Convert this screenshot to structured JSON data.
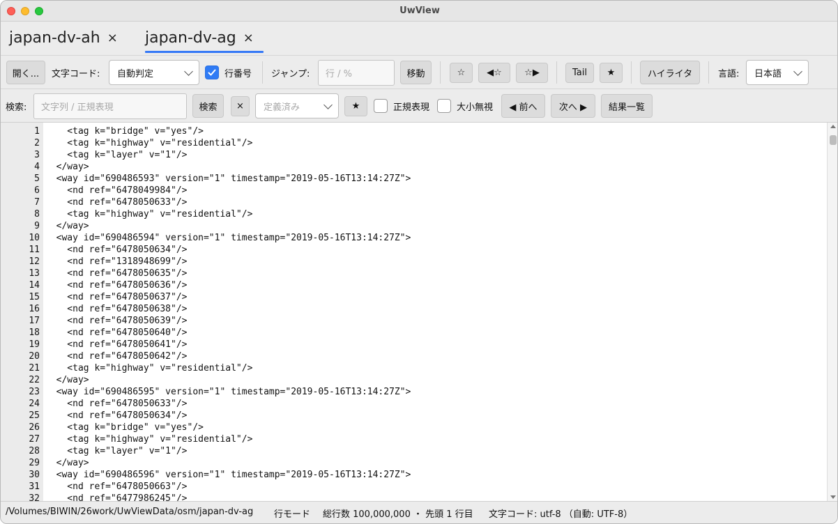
{
  "window": {
    "title": "UwView"
  },
  "tabs": [
    {
      "label": "japan-dv-ah",
      "close": "×"
    },
    {
      "label": "japan-dv-ag",
      "close": "×"
    }
  ],
  "toolbar1": {
    "open_label": "開く...",
    "encoding_label": "文字コード:",
    "encoding_value": "自動判定",
    "line_numbers_label": "行番号",
    "line_numbers_checked": true,
    "jump_label": "ジャンプ:",
    "jump_placeholder": "行 / %",
    "move_label": "移動",
    "bookmark_label": "☆",
    "prev_bookmark_label": "◀☆",
    "next_bookmark_label": "☆▶",
    "tail_label": "Tail",
    "star_label": "★",
    "highlighter_label": "ハイライタ",
    "language_label": "言語:",
    "language_value": "日本語"
  },
  "toolbar2": {
    "search_label": "検索:",
    "search_placeholder": "文字列 / 正規表現",
    "search_button": "検索",
    "clear_button": "×",
    "preset_placeholder": "定義済み",
    "preset_star": "★",
    "regex_label": "正規表現",
    "regex_checked": false,
    "ignore_case_label": "大小無視",
    "ignore_case_checked": false,
    "prev_label": "◀ 前へ",
    "next_label": "次へ ▶",
    "results_label": "結果一覧"
  },
  "editor": {
    "lines": [
      {
        "n": "1",
        "text": "    <tag k=\"bridge\" v=\"yes\"/>"
      },
      {
        "n": "2",
        "text": "    <tag k=\"highway\" v=\"residential\"/>"
      },
      {
        "n": "3",
        "text": "    <tag k=\"layer\" v=\"1\"/>"
      },
      {
        "n": "4",
        "text": "  </way>"
      },
      {
        "n": "5",
        "text": "  <way id=\"690486593\" version=\"1\" timestamp=\"2019-05-16T13:14:27Z\">"
      },
      {
        "n": "6",
        "text": "    <nd ref=\"6478049984\"/>"
      },
      {
        "n": "7",
        "text": "    <nd ref=\"6478050633\"/>"
      },
      {
        "n": "8",
        "text": "    <tag k=\"highway\" v=\"residential\"/>"
      },
      {
        "n": "9",
        "text": "  </way>"
      },
      {
        "n": "10",
        "text": "  <way id=\"690486594\" version=\"1\" timestamp=\"2019-05-16T13:14:27Z\">"
      },
      {
        "n": "11",
        "text": "    <nd ref=\"6478050634\"/>"
      },
      {
        "n": "12",
        "text": "    <nd ref=\"1318948699\"/>"
      },
      {
        "n": "13",
        "text": "    <nd ref=\"6478050635\"/>"
      },
      {
        "n": "14",
        "text": "    <nd ref=\"6478050636\"/>"
      },
      {
        "n": "15",
        "text": "    <nd ref=\"6478050637\"/>"
      },
      {
        "n": "16",
        "text": "    <nd ref=\"6478050638\"/>"
      },
      {
        "n": "17",
        "text": "    <nd ref=\"6478050639\"/>"
      },
      {
        "n": "18",
        "text": "    <nd ref=\"6478050640\"/>"
      },
      {
        "n": "19",
        "text": "    <nd ref=\"6478050641\"/>"
      },
      {
        "n": "20",
        "text": "    <nd ref=\"6478050642\"/>"
      },
      {
        "n": "21",
        "text": "    <tag k=\"highway\" v=\"residential\"/>"
      },
      {
        "n": "22",
        "text": "  </way>"
      },
      {
        "n": "23",
        "text": "  <way id=\"690486595\" version=\"1\" timestamp=\"2019-05-16T13:14:27Z\">"
      },
      {
        "n": "24",
        "text": "    <nd ref=\"6478050633\"/>"
      },
      {
        "n": "25",
        "text": "    <nd ref=\"6478050634\"/>"
      },
      {
        "n": "26",
        "text": "    <tag k=\"bridge\" v=\"yes\"/>"
      },
      {
        "n": "27",
        "text": "    <tag k=\"highway\" v=\"residential\"/>"
      },
      {
        "n": "28",
        "text": "    <tag k=\"layer\" v=\"1\"/>"
      },
      {
        "n": "29",
        "text": "  </way>"
      },
      {
        "n": "30",
        "text": "  <way id=\"690486596\" version=\"1\" timestamp=\"2019-05-16T13:14:27Z\">"
      },
      {
        "n": "31",
        "text": "    <nd ref=\"6478050663\"/>"
      },
      {
        "n": "32",
        "text": "    <nd ref=\"6477986245\"/>"
      }
    ]
  },
  "statusbar": {
    "path": "/Volumes/BIWIN/26work/UwViewData/osm/japan-dv-ag",
    "mode": "行モード",
    "total": "総行数 100,000,000 ・ 先頭 1 行目",
    "encoding": "文字コード: utf-8 （自動: UTF-8）"
  },
  "colors": {
    "accent": "#2f7bf5",
    "tab_underline": "#3478f6",
    "gutter": "#ebebeb"
  }
}
